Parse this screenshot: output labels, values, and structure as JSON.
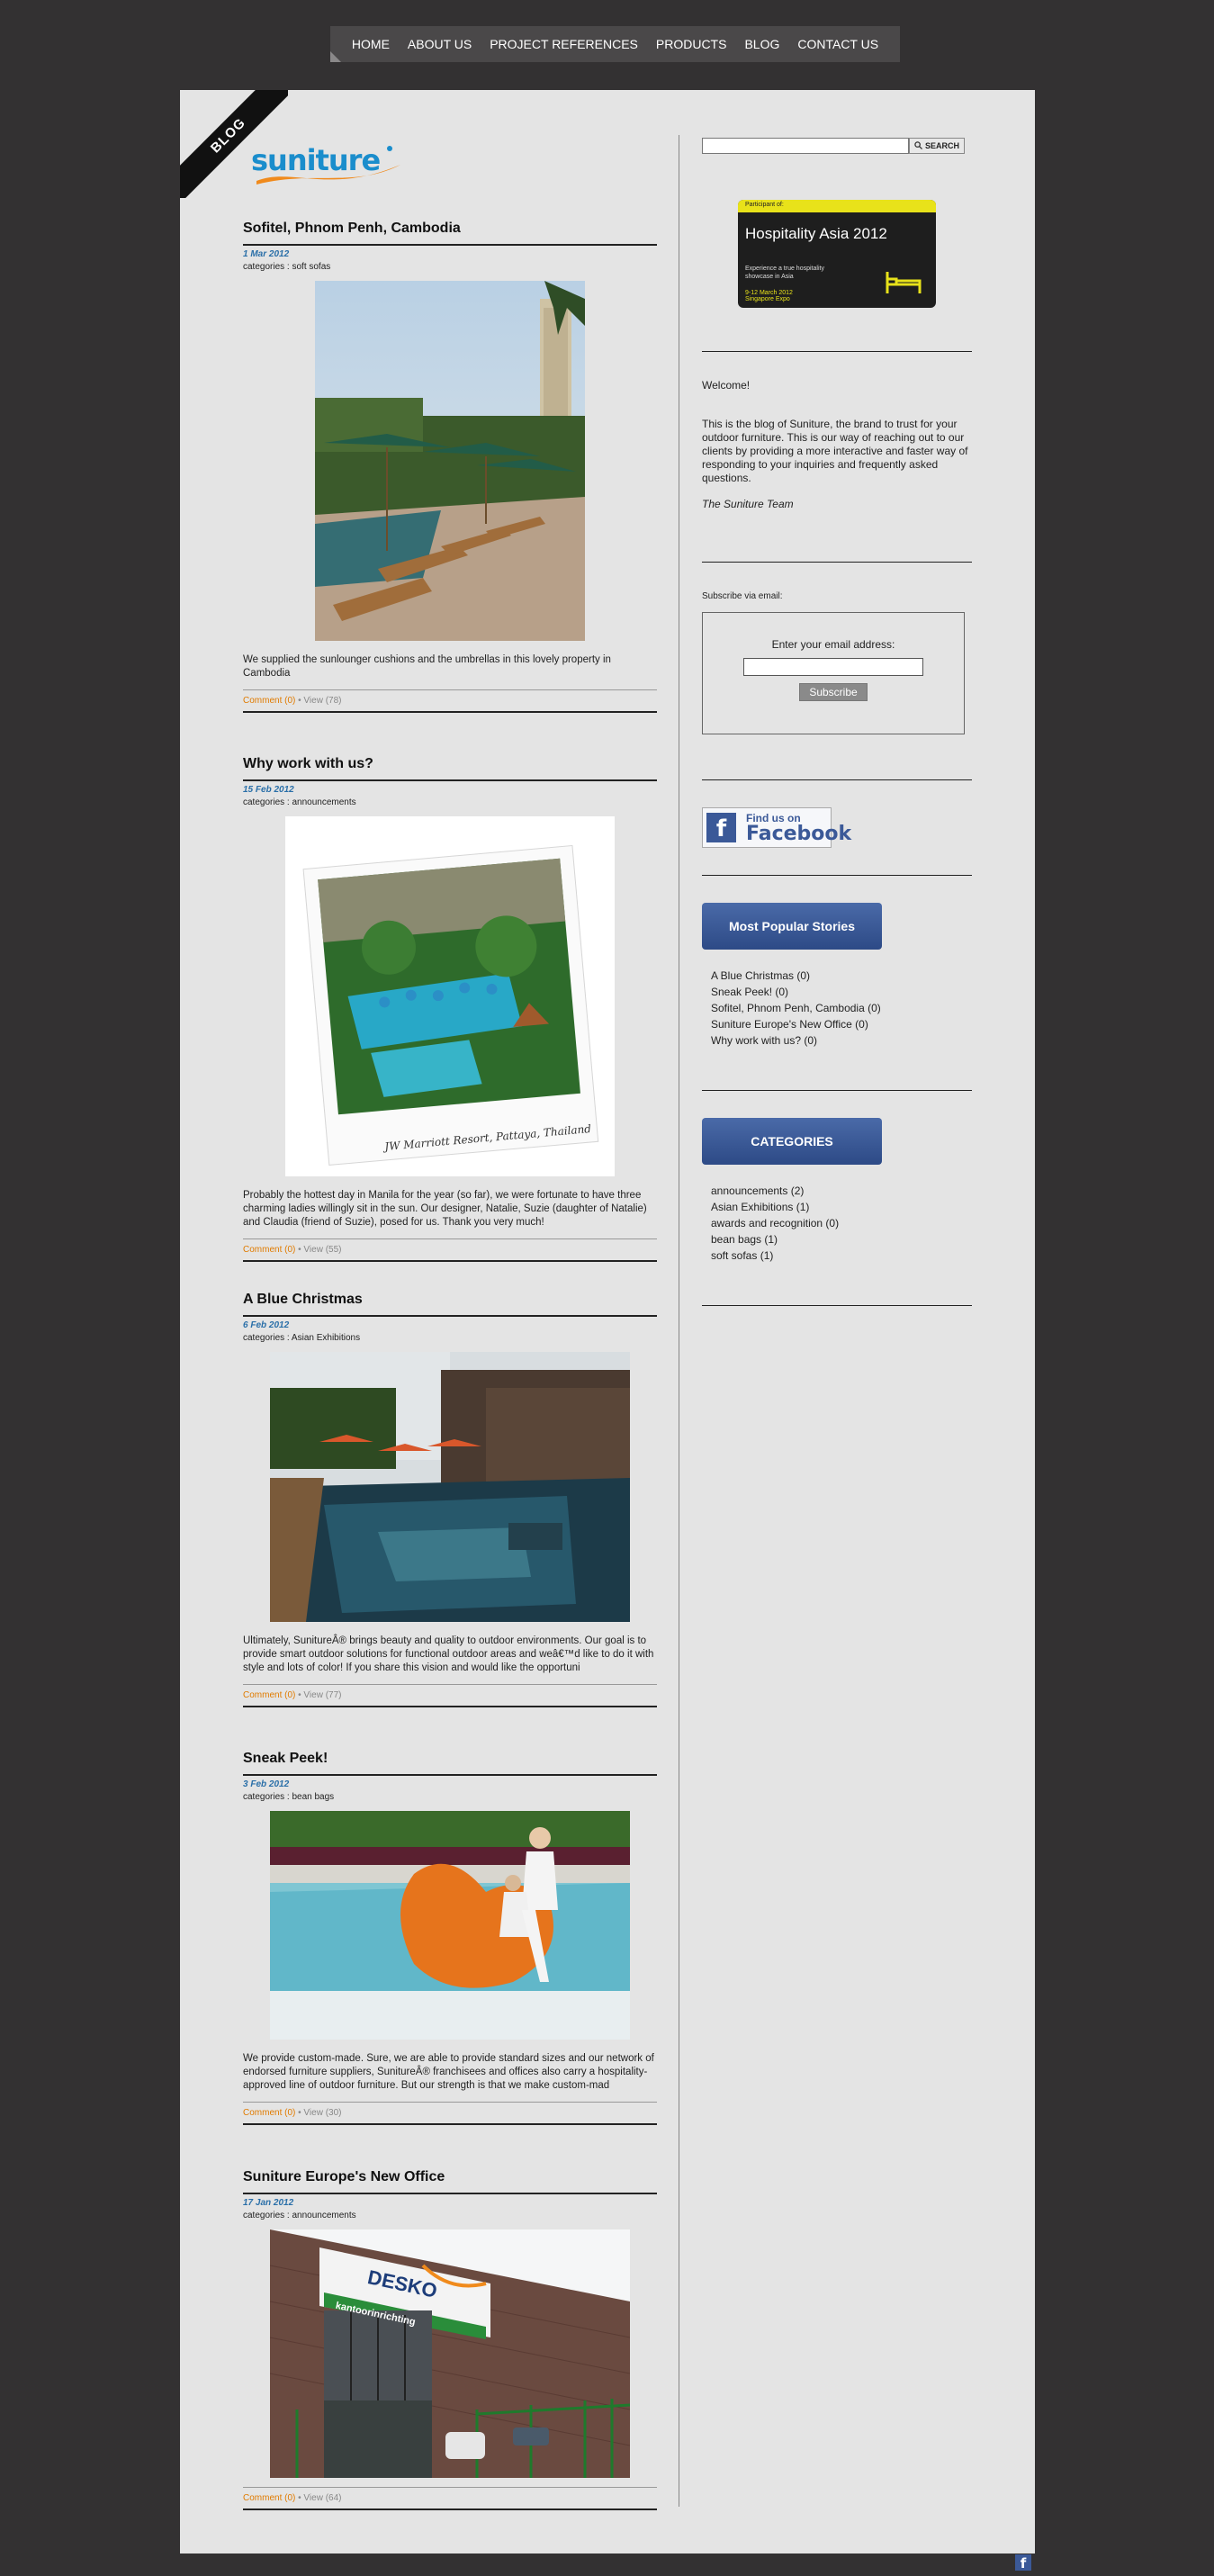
{
  "nav": {
    "items": [
      "HOME",
      "ABOUT US",
      "PROJECT REFERENCES",
      "PRODUCTS",
      "BLOG",
      "CONTACT US"
    ]
  },
  "ribbon": {
    "label": "BLOG"
  },
  "logo": {
    "text": "suniture"
  },
  "posts": [
    {
      "title": "Sofitel, Phnom Penh, Cambodia",
      "date": "1 Mar 2012",
      "category": "categories : soft sofas",
      "excerpt": "We supplied the sunlounger cushions and the umbrellas in this lovely property in Cambodia",
      "comment": "Comment (0)",
      "views": " • View (78)"
    },
    {
      "title": "Why work with us?",
      "date": "15 Feb 2012",
      "category": "categories : announcements",
      "image_caption": "JW Marriott Resort, Pattaya, Thailand",
      "excerpt": "Probably the hottest day in Manila for the year (so far), we were fortunate to have three charming ladies willingly sit in the sun. Our designer, Natalie, Suzie (daughter of Natalie) and Claudia (friend of Suzie), posed for us. Thank you very much!",
      "comment": "Comment (0)",
      "views": " • View (55)"
    },
    {
      "title": "A Blue Christmas",
      "date": "6 Feb 2012",
      "category": "categories : Asian Exhibitions",
      "excerpt": "Ultimately, SunitureÂ® brings beauty and quality to outdoor environments. Our goal is to provide smart outdoor solutions for functional outdoor areas and weâ€™d like to do it with style and lots of color! If you share this vision and would like the opportuni",
      "comment": "Comment (0)",
      "views": " • View (77)"
    },
    {
      "title": "Sneak Peek!",
      "date": "3 Feb 2012",
      "category": "categories : bean bags",
      "excerpt": "We provide custom-made. Sure, we are able to provide standard sizes and our network of endorsed furniture suppliers, SunitureÂ® franchisees and offices also carry a hospitality-approved line of outdoor furniture. But our strength is that we make custom-mad",
      "comment": "Comment (0)",
      "views": " • View (30)"
    },
    {
      "title": "Suniture Europe's New Office",
      "date": "17 Jan 2012",
      "category": "categories : announcements",
      "image_sign": "DESKO",
      "image_sign_sub": "kantoorinrichting",
      "comment": "Comment (0)",
      "views": " • View (64)"
    }
  ],
  "sidebar": {
    "search_button": "SEARCH",
    "banner": {
      "top": "Participant of:",
      "title": "Hospitality Asia 2012",
      "desc": "Experience a true hospitality showcase in Asia",
      "date": "9-12 March 2012",
      "venue": "Singapore Expo"
    },
    "welcome": "Welcome!",
    "intro": "This is the blog of Suniture, the brand to trust for your outdoor furniture. This is our way of reaching out to our clients by providing a more interactive and faster way of responding to your inquiries and frequently asked questions.",
    "signoff": "The Suniture Team",
    "subscribe_label": "Subscribe via email:",
    "subscribe_prompt": "Enter your email address:",
    "subscribe_button": "Subscribe",
    "facebook_small": "Find us on",
    "facebook_big": "Facebook",
    "popular_heading": "Most Popular Stories",
    "popular": [
      "A Blue Christmas (0)",
      "Sneak Peek! (0)",
      "Sofitel, Phnom Penh, Cambodia (0)",
      "Suniture Europe's New Office (0)",
      "Why work with us? (0)"
    ],
    "categories_heading": "CATEGORIES",
    "categories": [
      "announcements (2)",
      "Asian Exhibitions (1)",
      "awards and recognition (0)",
      "bean bags (1)",
      "soft sofas (1)"
    ]
  }
}
